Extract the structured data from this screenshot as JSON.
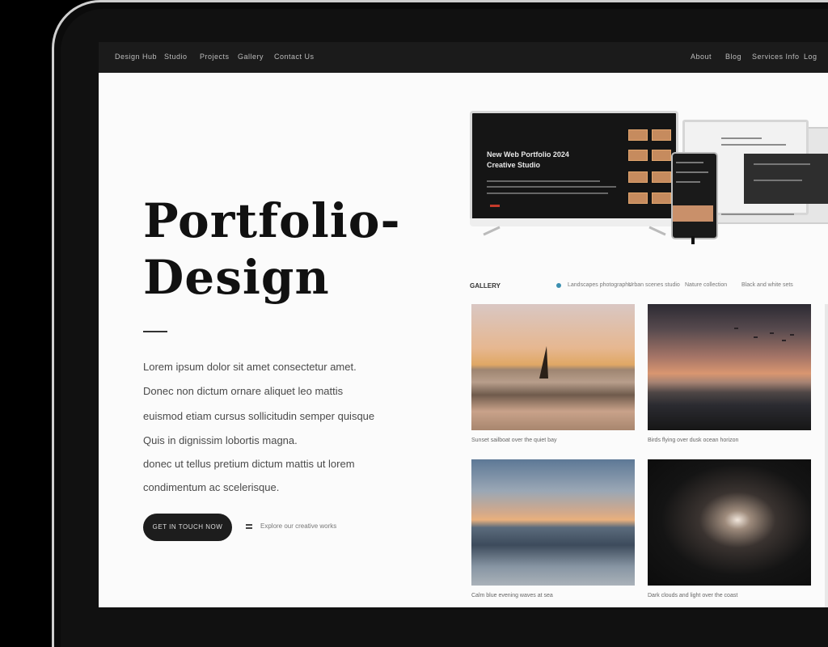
{
  "nav": {
    "left": [
      "Design Hub",
      "Studio",
      "Projects",
      "Gallery",
      "Contact Us"
    ],
    "right": [
      "About",
      "Blog",
      "Services Info",
      "Log"
    ]
  },
  "hero": {
    "title_line1": "Portfolio-",
    "title_line2": "Design",
    "body_lines": [
      "Lorem ipsum dolor sit amet consectetur amet.",
      "Donec non dictum ornare aliquet leo mattis",
      "euismod etiam cursus sollicitudin semper quisque",
      "Quis in dignissim lobortis magna.",
      "donec ut tellus pretium dictum mattis ut lorem",
      "condimentum ac scelerisque."
    ],
    "cta_label": "GET IN TOUCH NOW",
    "cta_link": "Explore our creative works"
  },
  "device": {
    "headline_line1": "New Web Portfolio 2024",
    "headline_line2": "Creative Studio"
  },
  "gallery": {
    "title": "GALLERY",
    "nav": [
      "Landscapes photographs",
      "Urban scenes studio",
      "Nature collection",
      "Black and white sets"
    ],
    "captions": [
      "Sunset sailboat over the quiet bay",
      "Birds flying over dusk ocean horizon",
      "Calm blue evening waves at sea",
      "Dark clouds and light over the coast"
    ]
  },
  "colors": {
    "nav_bg": "#1b1b1b",
    "screen_bg": "#fbfbfb",
    "cta_bg": "#1d1d1d",
    "accent_blue": "#3b8fb0"
  }
}
